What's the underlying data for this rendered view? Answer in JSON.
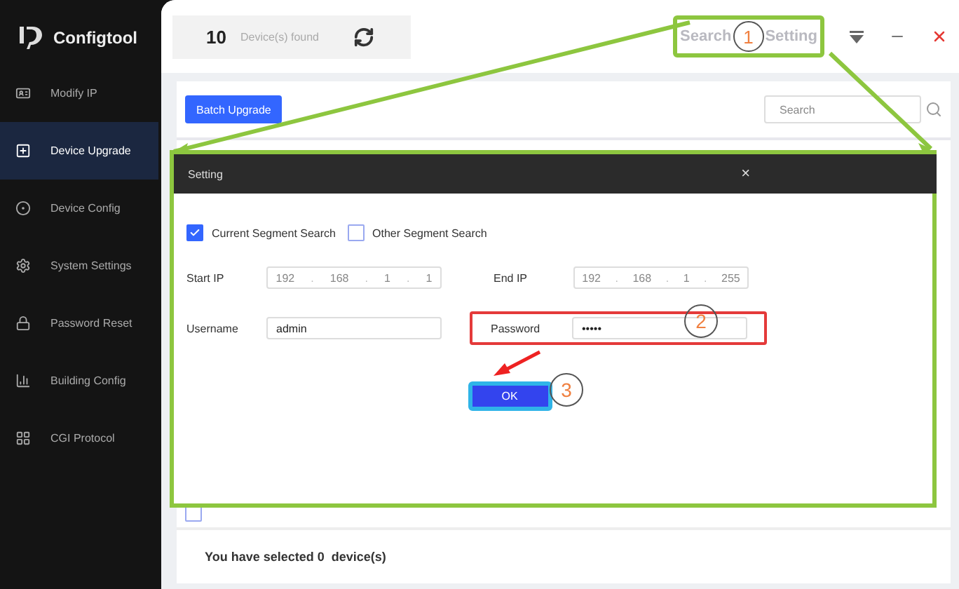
{
  "sidebar": {
    "app_name": "Configtool",
    "items": [
      {
        "label": "Modify IP",
        "selected": false
      },
      {
        "label": "Device Upgrade",
        "selected": true
      },
      {
        "label": "Device Config",
        "selected": false
      },
      {
        "label": "System Settings",
        "selected": false
      },
      {
        "label": "Password Reset",
        "selected": false
      },
      {
        "label": "Building Config",
        "selected": false
      },
      {
        "label": "CGI Protocol",
        "selected": false
      }
    ]
  },
  "header": {
    "device_count": "10",
    "device_count_label": "Device(s) found",
    "search_setting": {
      "words": [
        "Search",
        "Setting"
      ]
    }
  },
  "toolbar": {
    "batch_upgrade": "Batch Upgrade",
    "search": {
      "placeholder": "Search"
    }
  },
  "table": {
    "rows": [
      {
        "checked": false
      }
    ]
  },
  "footer": {
    "selection": "You have selected 0  device(s)"
  },
  "dialog": {
    "title": "Setting",
    "close": "×",
    "segments": [
      {
        "label": "Current Segment Search",
        "selected": true
      },
      {
        "label": "Other Segment Search",
        "selected": false
      }
    ],
    "start_ip": {
      "label": "Start IP",
      "separator": ".",
      "octets": [
        "192",
        "168",
        "1",
        "1"
      ]
    },
    "end_ip": {
      "label": "End IP",
      "separator": ".",
      "octets": [
        "192",
        "168",
        "1",
        "255"
      ]
    },
    "username": {
      "label": "Username",
      "value": "admin"
    },
    "password": {
      "label": "Password",
      "value": "•••••"
    },
    "ok": "OK"
  },
  "callouts": [
    {
      "number": "1"
    },
    {
      "number": "2"
    },
    {
      "number": "3"
    }
  ]
}
